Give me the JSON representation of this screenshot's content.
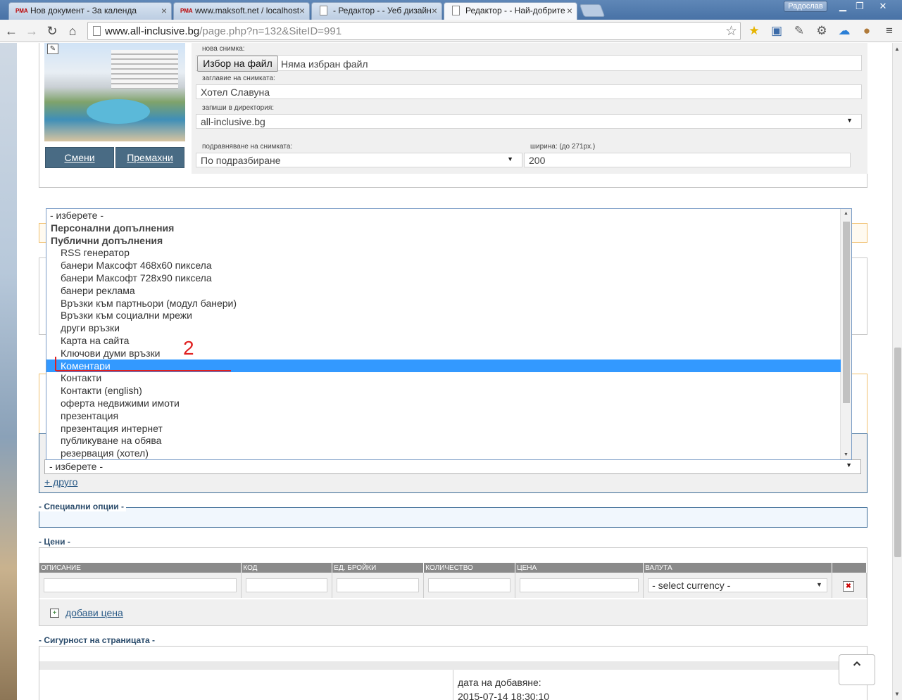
{
  "browser": {
    "tabs": [
      {
        "title": "Нов документ - За календа",
        "icon": "maksoft-favicon"
      },
      {
        "title": "www.maksoft.net / localhost",
        "icon": "maksoft-favicon"
      },
      {
        "title": "- Редактор - - Уеб дизайн",
        "icon": "document-icon"
      },
      {
        "title": "Редактор - - Най-добрите",
        "icon": "document-icon"
      }
    ],
    "user_name": "Радослав",
    "url_domain": "www.all-inclusive.bg",
    "url_path": "/page.php?n=132&SiteID=991"
  },
  "image_editor": {
    "change_label": "Смени",
    "remove_label": "Премахни",
    "new_image_label": "нова снимка:",
    "file_button": "Избор на файл",
    "file_status": "Няма избран файл",
    "caption_label": "заглавие на снимката:",
    "caption_value": "Хотел Славуна",
    "directory_label": "запиши в директория:",
    "directory_value": "all-inclusive.bg",
    "align_label": "подравняване на снимката:",
    "align_value": "По подразбиране",
    "width_label": "ширина: (до 271px.)",
    "width_value": "200"
  },
  "dropdown": {
    "items": [
      {
        "label": "- изберете -",
        "kind": "top"
      },
      {
        "label": "Персонални допълнения",
        "kind": "group"
      },
      {
        "label": "Публични допълнения",
        "kind": "group"
      },
      {
        "label": "RSS генератор",
        "kind": "option"
      },
      {
        "label": "банери Максофт 468x60 пиксела",
        "kind": "option"
      },
      {
        "label": "банери Максофт 728x90 пиксела",
        "kind": "option"
      },
      {
        "label": "банери реклама",
        "kind": "option"
      },
      {
        "label": "Връзки към партньори (модул банери)",
        "kind": "option"
      },
      {
        "label": "Връзки към социални мрежи",
        "kind": "option"
      },
      {
        "label": "други връзки",
        "kind": "option"
      },
      {
        "label": "Карта на сайта",
        "kind": "option"
      },
      {
        "label": "Ключови думи връзки",
        "kind": "option"
      },
      {
        "label": "Коментари",
        "kind": "selected"
      },
      {
        "label": "Контакти",
        "kind": "option"
      },
      {
        "label": "Контакти (english)",
        "kind": "option"
      },
      {
        "label": "оферта недвижими имоти",
        "kind": "option"
      },
      {
        "label": "презентация",
        "kind": "option"
      },
      {
        "label": "презентация интернет",
        "kind": "option"
      },
      {
        "label": "публикуване на обява",
        "kind": "option"
      },
      {
        "label": "резервация (хотел)",
        "kind": "option"
      }
    ],
    "select_value": "- изберете -",
    "add_other": "+ друго"
  },
  "annotation": {
    "number": "2",
    "color": "#e02020"
  },
  "special_options": {
    "title": "- Специални опции -"
  },
  "prices": {
    "title": "- Цени -",
    "columns": [
      "ОПИСАНИЕ",
      "КОД",
      "ЕД. БРОЙКИ",
      "КОЛИЧЕСТВО",
      "ЦЕНА",
      "ВАЛУТА"
    ],
    "currency_placeholder": "- select currency -",
    "add_price": "добави цена"
  },
  "security": {
    "title": "- Сигурност на страницата -",
    "date_added_label": "дата на добавяне:",
    "date_added_value": "2015-07-14 18:30:10"
  },
  "colors": {
    "accent": "#3399ff",
    "button": "#496b84",
    "section_title": "#2a4b6b"
  }
}
